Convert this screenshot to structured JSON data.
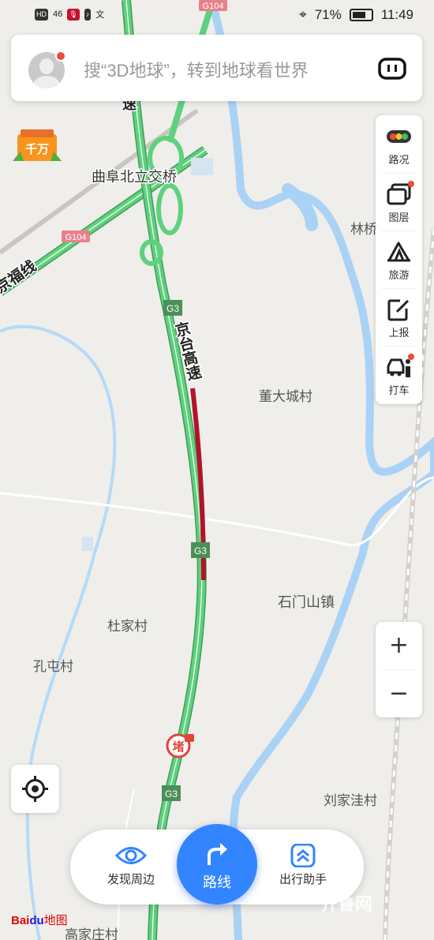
{
  "status_bar": {
    "left_icons": [
      "HD",
      "46",
      "mic-icon",
      "tiktok-icon",
      "translate-icon"
    ],
    "battery_percent": "71%",
    "time": "11:49"
  },
  "search": {
    "placeholder": "搜“3D地球”，转到地球看世界"
  },
  "tools": [
    {
      "label": "路况",
      "icon": "traffic-light-icon",
      "badge": false
    },
    {
      "label": "图层",
      "icon": "layers-icon",
      "badge": true
    },
    {
      "label": "旅游",
      "icon": "tourism-icon",
      "badge": false
    },
    {
      "label": "上报",
      "icon": "report-edit-icon",
      "badge": false
    },
    {
      "label": "打车",
      "icon": "taxi-icon",
      "badge": true
    }
  ],
  "zoom": {
    "in": "+",
    "out": "−"
  },
  "promo": {
    "text": "千万"
  },
  "map_labels": {
    "interchange": "曲阜北立交桥",
    "road_g104_top": "G104",
    "road_g104_left": "G104",
    "railway": "京福线",
    "expressway_cut": "速",
    "expressway": "京台高速",
    "shield_1": "G3",
    "shield_2": "G3",
    "shield_3": "G3",
    "village_1": "董大城村",
    "village_2": "林桥",
    "town": "石门山镇",
    "village_3": "杜家村",
    "village_4": "孔屯村",
    "village_5": "刘家洼村",
    "village_6": "高家庄村",
    "jam_icon": "堵"
  },
  "bottom_bar": {
    "nearby": "发现周边",
    "route": "路线",
    "assistant": "出行助手"
  },
  "branding": {
    "logo": "Baidu地图",
    "watermark": "齐鲁网"
  },
  "colors": {
    "road_green": "#5fd17e",
    "jam_red": "#b1132b",
    "water": "#a9d2f5",
    "accent_blue": "#3385ff",
    "badge_red": "#f04b3c"
  }
}
